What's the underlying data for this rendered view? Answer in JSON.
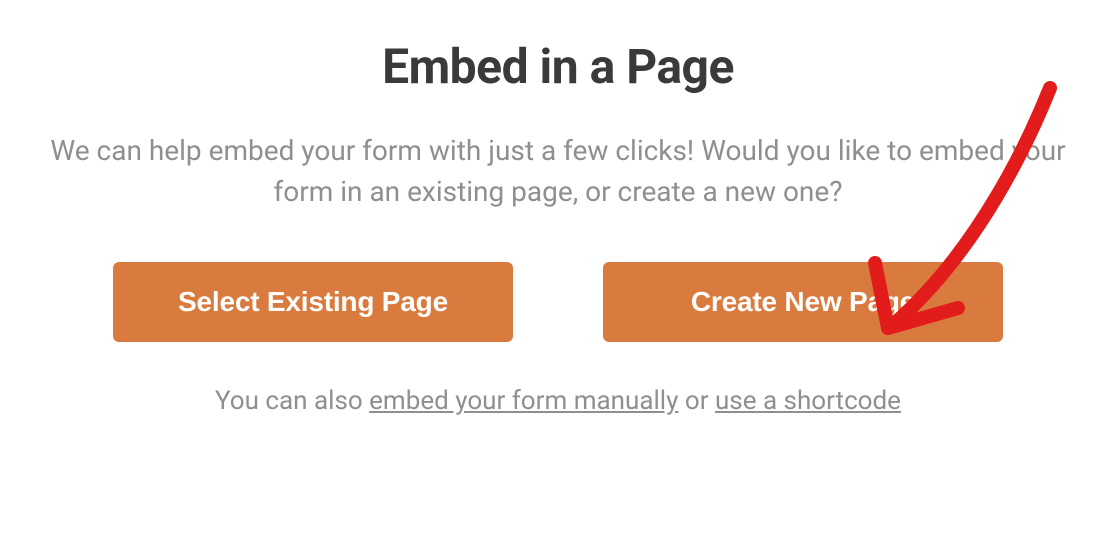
{
  "dialog": {
    "title": "Embed in a Page",
    "description": "We can help embed your form with just a few clicks! Would you like to embed your form in an existing page, or create a new one?",
    "buttons": {
      "existing": "Select Existing Page",
      "create": "Create New Page"
    },
    "footer": {
      "prefix": "You can also ",
      "link1": "embed your form manually",
      "mid": " or ",
      "link2": "use a shortcode"
    }
  },
  "annotation": {
    "target": "create-new-page-button",
    "color": "#e21b1b"
  }
}
